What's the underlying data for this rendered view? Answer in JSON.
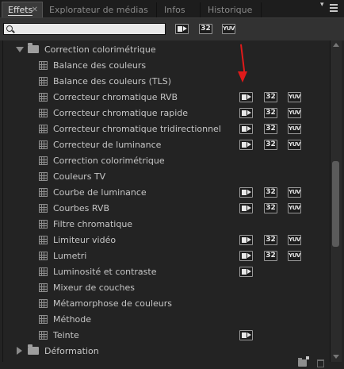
{
  "tabs": [
    {
      "label": "Effets"
    },
    {
      "label": "Explorateur de médias"
    },
    {
      "label": "Infos"
    },
    {
      "label": "Historique"
    }
  ],
  "search": {
    "value": "",
    "placeholder": ""
  },
  "badges": {
    "accel": "",
    "b32": "32",
    "yuv": "YUV"
  },
  "tree": {
    "expanded_folder": "Correction colorimétrique",
    "items": [
      {
        "label": "Balance des couleurs",
        "accel": false,
        "b32": false,
        "yuv": false
      },
      {
        "label": "Balance des couleurs (TLS)",
        "accel": false,
        "b32": false,
        "yuv": false
      },
      {
        "label": "Correcteur chromatique RVB",
        "accel": true,
        "b32": true,
        "yuv": true
      },
      {
        "label": "Correcteur chromatique rapide",
        "accel": true,
        "b32": true,
        "yuv": true
      },
      {
        "label": "Correcteur chromatique tridirectionnel",
        "accel": true,
        "b32": true,
        "yuv": true
      },
      {
        "label": "Correcteur de luminance",
        "accel": true,
        "b32": true,
        "yuv": true
      },
      {
        "label": "Correction colorimétrique",
        "accel": false,
        "b32": false,
        "yuv": false
      },
      {
        "label": "Couleurs TV",
        "accel": false,
        "b32": false,
        "yuv": false
      },
      {
        "label": "Courbe de luminance",
        "accel": true,
        "b32": true,
        "yuv": true
      },
      {
        "label": "Courbes RVB",
        "accel": true,
        "b32": true,
        "yuv": true
      },
      {
        "label": "Filtre chromatique",
        "accel": false,
        "b32": false,
        "yuv": false
      },
      {
        "label": "Limiteur vidéo",
        "accel": true,
        "b32": true,
        "yuv": true
      },
      {
        "label": "Lumetri",
        "accel": true,
        "b32": true,
        "yuv": true
      },
      {
        "label": "Luminosité et contraste",
        "accel": true,
        "b32": false,
        "yuv": false
      },
      {
        "label": "Mixeur de couches",
        "accel": false,
        "b32": false,
        "yuv": false
      },
      {
        "label": "Métamorphose de couleurs",
        "accel": false,
        "b32": false,
        "yuv": false
      },
      {
        "label": "Méthode",
        "accel": false,
        "b32": false,
        "yuv": false
      },
      {
        "label": "Teinte",
        "accel": true,
        "b32": false,
        "yuv": false
      }
    ],
    "collapsed_folder": "Déformation"
  },
  "annotation_color": "#e01a1a"
}
